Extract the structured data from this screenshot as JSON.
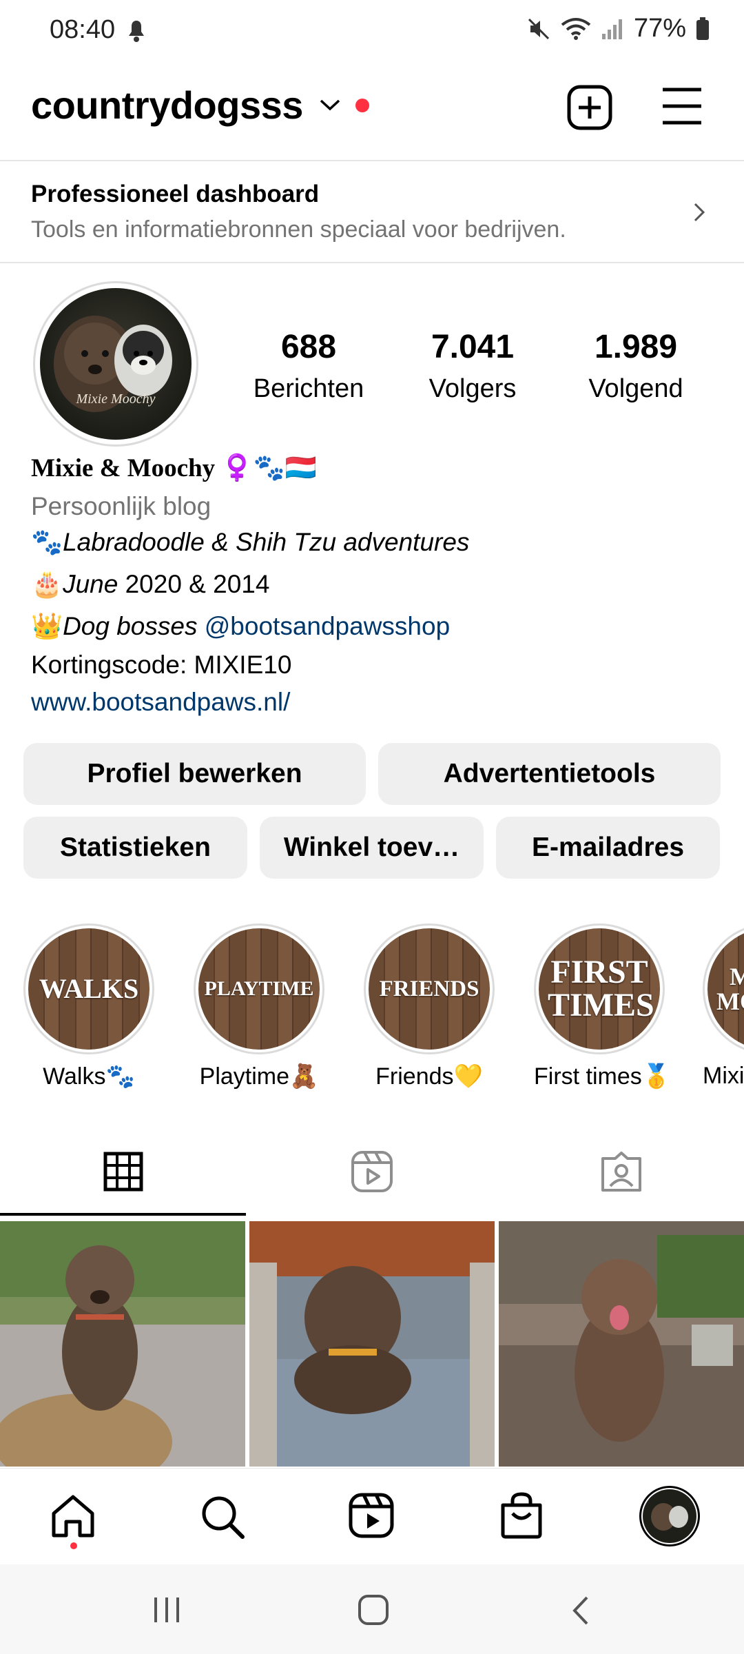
{
  "status_bar": {
    "time": "08:40",
    "battery": "77%"
  },
  "header": {
    "username": "countrydogsss"
  },
  "dashboard": {
    "title": "Professioneel dashboard",
    "subtitle": "Tools en informatiebronnen speciaal voor bedrijven."
  },
  "profile": {
    "avatar_text": "Mixie Moochy",
    "stats": [
      {
        "value": "688",
        "label": "Berichten"
      },
      {
        "value": "7.041",
        "label": "Volgers"
      },
      {
        "value": "1.989",
        "label": "Volgend"
      }
    ],
    "name": "Mixie & Moochy ♀️🐾🇱🇺",
    "category": "Persoonlijk blog",
    "bio": {
      "line1_emoji": "🐾",
      "line1_text": "Labradoodle & Shih Tzu adventures",
      "line2_emoji": "🎂",
      "line2_italic": "June",
      "line2_text": " 2020 & 2014",
      "line3_emoji": "👑",
      "line3_italic": "Dog bosses ",
      "line3_mention": "@bootsandpawsshop",
      "line4": "Kortingscode: MIXIE10",
      "line5_link": "www.bootsandpaws.nl/"
    }
  },
  "buttons": {
    "edit_profile": "Profiel bewerken",
    "ad_tools": "Advertentietools",
    "insights": "Statistieken",
    "add_shop": "Winkel toev…",
    "email": "E-mailadres"
  },
  "highlights": [
    {
      "cover": "WALKS",
      "label": "Walks🐾"
    },
    {
      "cover": "PLAYTIME",
      "label": "Playtime🧸"
    },
    {
      "cover": "FRIENDS",
      "label": "Friends💛"
    },
    {
      "cover": "FIRST TIMES",
      "label": "First times🥇"
    },
    {
      "cover": "MIXIE MOOCHY",
      "label": "Mixie"
    }
  ],
  "tabs": {
    "icons": [
      "grid-icon",
      "reels-icon",
      "tagged-icon"
    ]
  },
  "colors": {
    "accent_red": "#ff3040",
    "link_blue": "#00376b",
    "button_bg": "#efefef",
    "secondary_text": "#737373"
  }
}
